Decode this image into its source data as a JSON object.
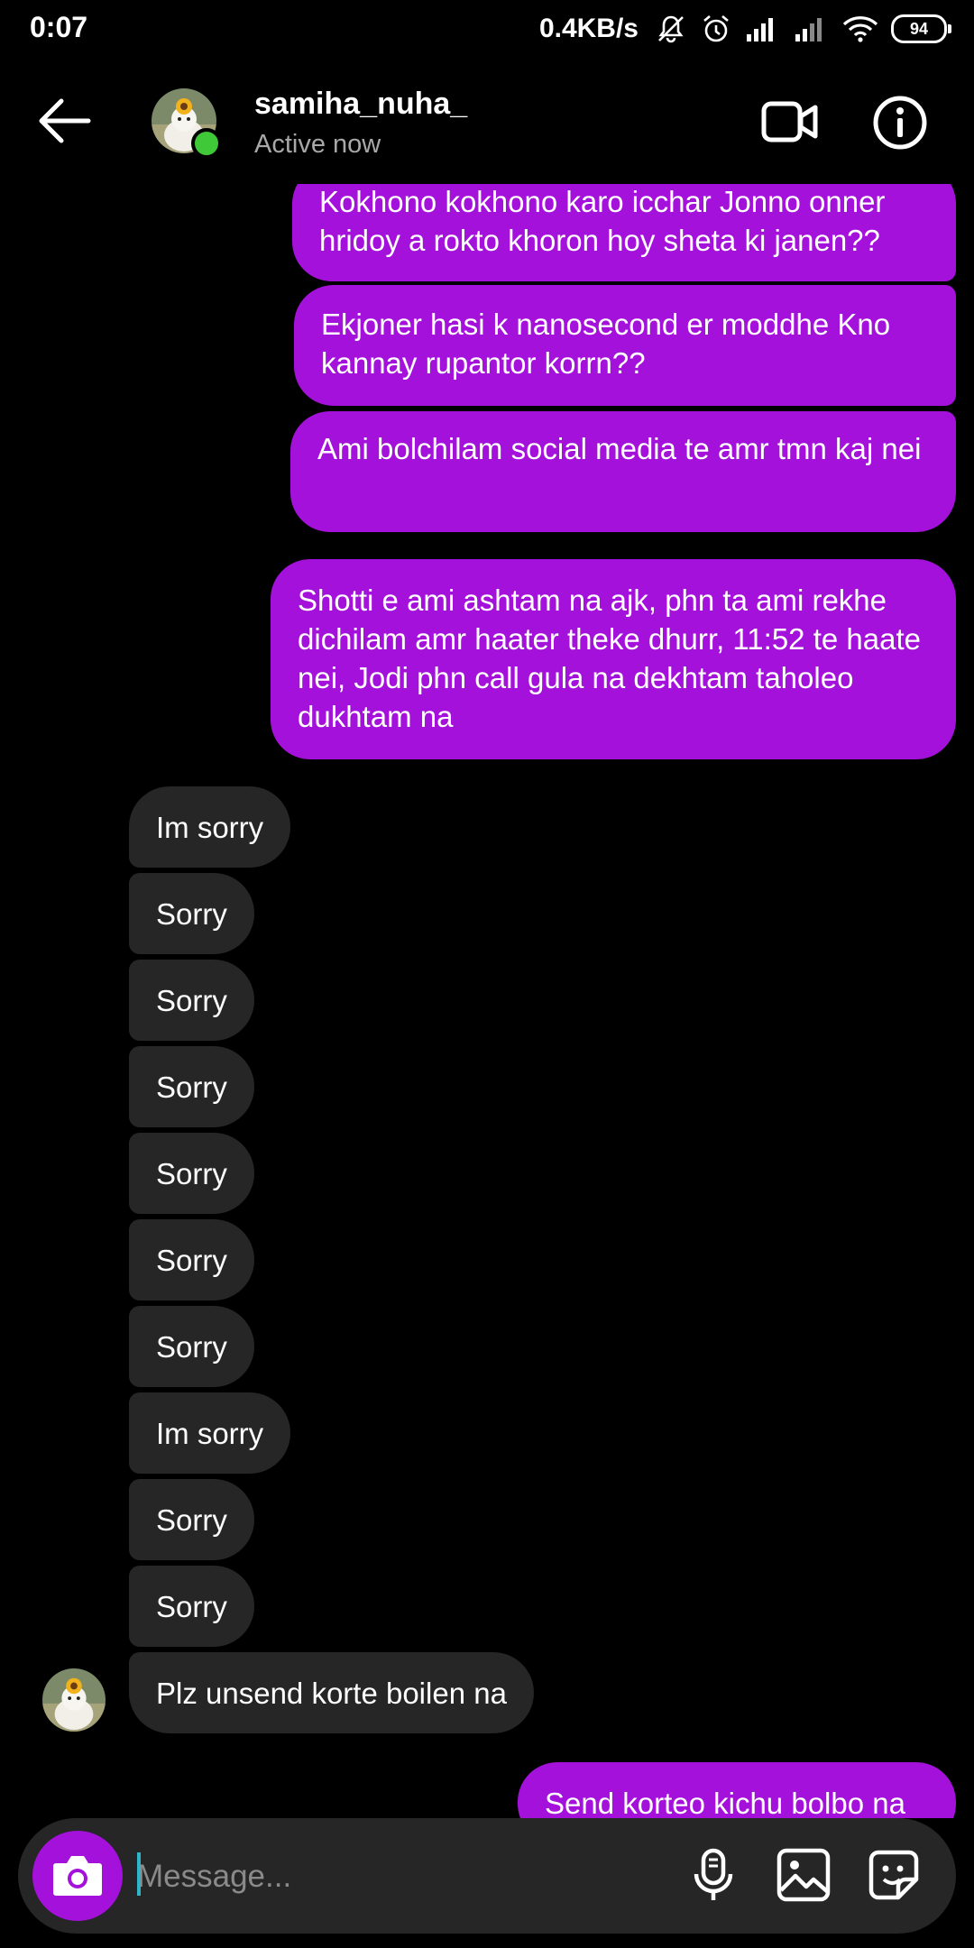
{
  "status_bar": {
    "time": "0:07",
    "net_speed": "0.4KB/s",
    "battery": "94"
  },
  "header": {
    "username": "samiha_nuha_",
    "presence": "Active now"
  },
  "messages": {
    "outgoing": [
      "Kokhono kokhono karo icchar Jonno onner hridoy a rokto khoron hoy sheta ki janen??",
      "Ekjoner hasi k nanosecond er moddhe Kno kannay rupantor korrn??",
      "Ami bolchilam social media te amr tmn kaj nei",
      "Shotti e ami ashtam na ajk, phn ta ami rekhe dichilam amr haater theke dhurr, 11:52 te haate nei, Jodi phn call gula na dekhtam taholeo dukhtam na",
      "Send korteo kichu bolbo na"
    ],
    "incoming": [
      "Im sorry",
      "Sorry",
      "Sorry",
      "Sorry",
      "Sorry",
      "Sorry",
      "Sorry",
      "Im sorry",
      "Sorry",
      "Sorry",
      "Plz unsend korte boilen na"
    ]
  },
  "composer": {
    "placeholder": "Message..."
  },
  "colors": {
    "outgoing_bubble": "#a411db",
    "incoming_bubble": "#262626",
    "online": "#3fc837",
    "background": "#000000"
  },
  "icons": [
    "back-arrow-icon",
    "video-call-icon",
    "info-icon",
    "camera-icon",
    "microphone-icon",
    "gallery-icon",
    "sticker-icon"
  ]
}
